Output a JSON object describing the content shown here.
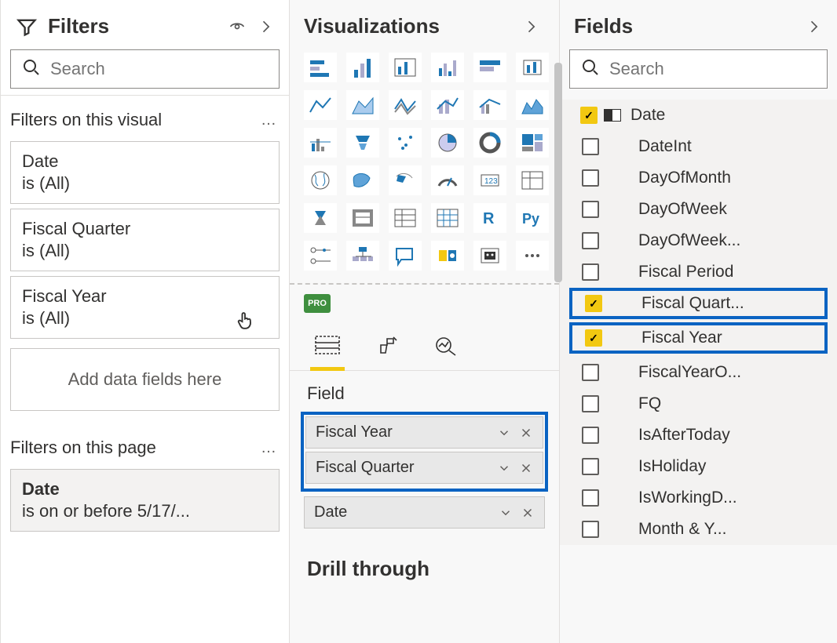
{
  "filters": {
    "title": "Filters",
    "search_placeholder": "Search",
    "section_visual": "Filters on this visual",
    "section_page": "Filters on this page",
    "add_placeholder": "Add data fields here",
    "visual_cards": [
      {
        "name": "Date",
        "summary": "is (All)"
      },
      {
        "name": "Fiscal Quarter",
        "summary": "is (All)"
      },
      {
        "name": "Fiscal Year",
        "summary": "is (All)"
      }
    ],
    "page_cards": [
      {
        "name": "Date",
        "summary": "is on or before 5/17/..."
      }
    ]
  },
  "viz": {
    "title": "Visualizations",
    "pro_badge": "PRO",
    "field_label": "Field",
    "wells": [
      {
        "label": "Fiscal Year",
        "highlight": true
      },
      {
        "label": "Fiscal Quarter",
        "highlight": true
      },
      {
        "label": "Date",
        "highlight": false
      }
    ],
    "drill_title": "Drill through"
  },
  "fields": {
    "title": "Fields",
    "search_placeholder": "Search",
    "table_name": "Date",
    "items": [
      {
        "label": "DateInt",
        "checked": false
      },
      {
        "label": "DayOfMonth",
        "checked": false
      },
      {
        "label": "DayOfWeek",
        "checked": false
      },
      {
        "label": "DayOfWeek...",
        "checked": false
      },
      {
        "label": "Fiscal Period",
        "checked": false
      },
      {
        "label": "Fiscal Quart...",
        "checked": true,
        "highlight": true
      },
      {
        "label": "Fiscal Year",
        "checked": true,
        "highlight": true
      },
      {
        "label": "FiscalYearO...",
        "checked": false
      },
      {
        "label": "FQ",
        "checked": false
      },
      {
        "label": "IsAfterToday",
        "checked": false
      },
      {
        "label": "IsHoliday",
        "checked": false
      },
      {
        "label": "IsWorkingD...",
        "checked": false
      },
      {
        "label": "Month & Y...",
        "checked": false
      }
    ]
  }
}
